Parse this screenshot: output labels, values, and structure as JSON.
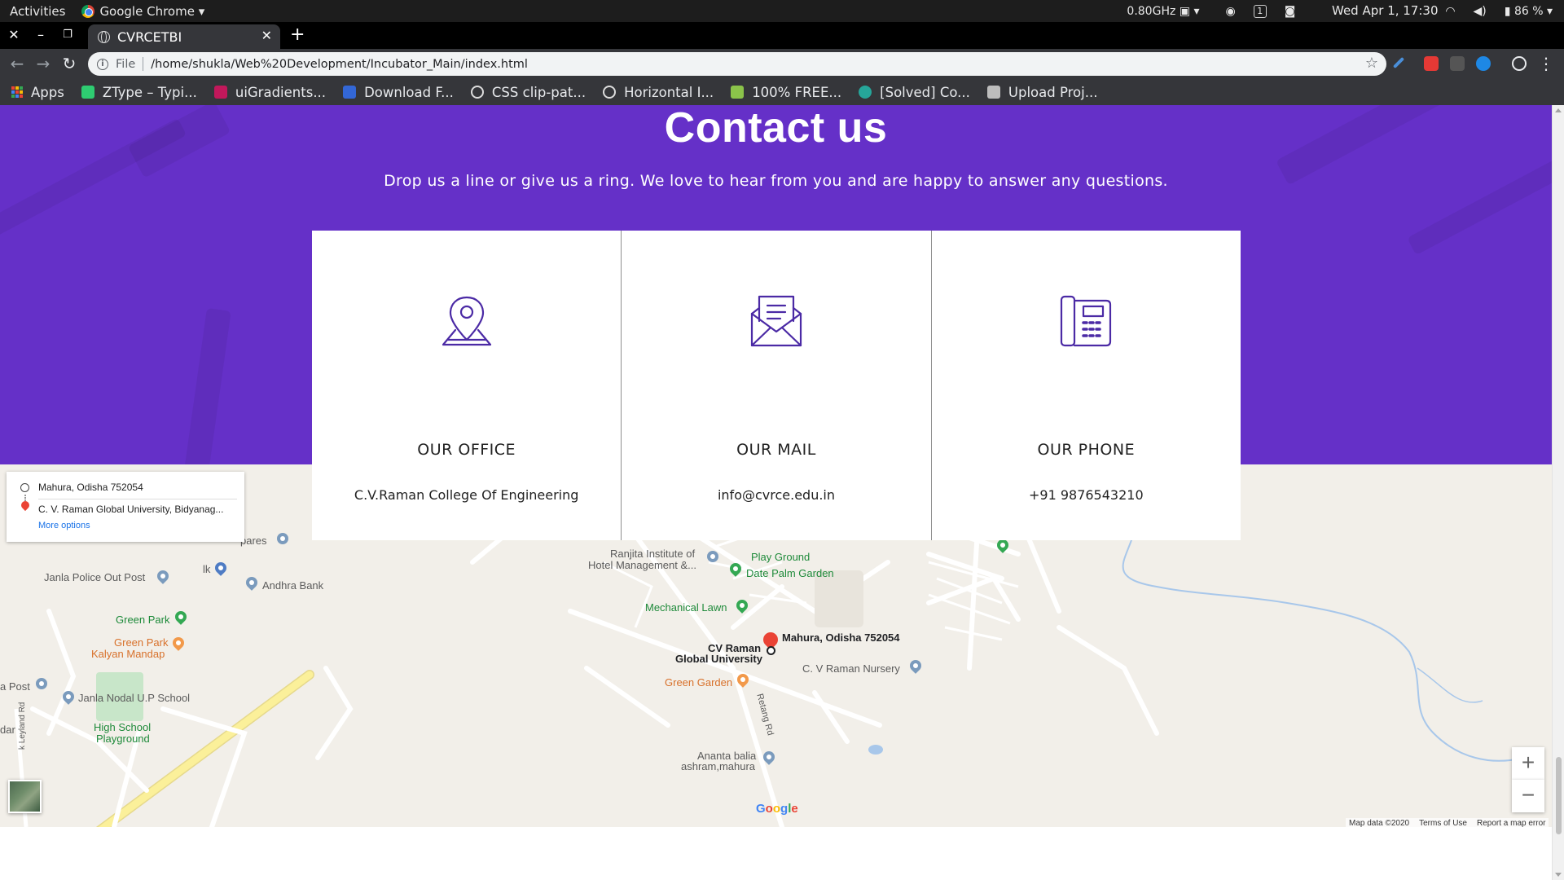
{
  "os_bar": {
    "activities": "Activities",
    "app_name": "Google Chrome",
    "cpu": "0.80GHz",
    "workspace": "1",
    "clock": "Wed Apr  1, 17:30",
    "battery": "86 %"
  },
  "browser": {
    "tab_title": "CVRCETBI",
    "url_scheme": "File",
    "url": "/home/shukla/Web%20Development/Incubator_Main/index.html",
    "bookmarks": [
      {
        "label": "Apps"
      },
      {
        "label": "ZType – Typi...",
        "color": "#2ecc71"
      },
      {
        "label": "uiGradients...",
        "color": "#c2185b"
      },
      {
        "label": "Download F...",
        "color": "#3367d6"
      },
      {
        "label": "CSS clip-pat...",
        "color": "#dddddd"
      },
      {
        "label": "Horizontal I...",
        "color": "#dddddd"
      },
      {
        "label": "100% FREE...",
        "color": "#8bc34a"
      },
      {
        "label": "[Solved] Co...",
        "color": "#26a69a"
      },
      {
        "label": "Upload Proj...",
        "color": "#bdbdbd"
      }
    ]
  },
  "hero": {
    "title": "Contact us",
    "subtitle": "Drop us a line or give us a ring. We love to hear from you and are happy to answer any questions.",
    "color": "#6530c8"
  },
  "cards": [
    {
      "icon": "location-pin-icon",
      "title": "OUR OFFICE",
      "text": "C.V.Raman College Of Engineering"
    },
    {
      "icon": "mail-envelope-icon",
      "title": "OUR MAIL",
      "text": "info@cvrce.edu.in"
    },
    {
      "icon": "telephone-icon",
      "title": "OUR PHONE",
      "text": "+91 9876543210"
    }
  ],
  "map": {
    "directions": {
      "origin": "Mahura, Odisha 752054",
      "destination": "C. V. Raman Global University, Bidyanag...",
      "more_options": "More options"
    },
    "labels": {
      "janla_police": "Janla Police Out Post",
      "andhra_bank": "Andhra Bank",
      "green_park": "Green Park",
      "green_park_kalyan_1": "Green Park",
      "green_park_kalyan_2": "Kalyan Mandap",
      "janla_nodal": "Janla Nodal U.P School",
      "high_school_1": "High School",
      "high_school_2": "Playground",
      "post": "a Post",
      "dar": "dar",
      "ares": "pares",
      "lk": "lk",
      "ranjita_1": "Ranjita Institute of",
      "ranjita_2": "Hotel Management &...",
      "play_ground": "Play Ground",
      "date_palm": "Date Palm Garden",
      "mechanical_lawn": "Mechanical Lawn",
      "mahura": "Mahura, Odisha 752054",
      "cv_raman_1": "CV Raman",
      "cv_raman_2": "Global University",
      "nursery": "C. V Raman Nursery",
      "green_garden": "Green Garden",
      "retang_rd": "Retang Rd",
      "ananta_1": "Ananta balia",
      "ananta_2": "ashram,mahura",
      "leyland": "k Leyland Rd"
    },
    "zoom_in": "+",
    "zoom_out": "−",
    "footer": {
      "data": "Map data ©2020",
      "terms": "Terms of Use",
      "report": "Report a map error"
    }
  }
}
